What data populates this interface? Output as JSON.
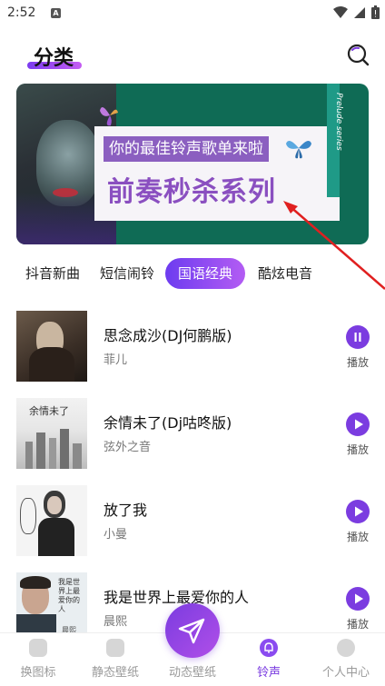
{
  "status_bar": {
    "time": "2:52",
    "notification_letter": "A"
  },
  "header": {
    "title": "分类"
  },
  "banner": {
    "subtitle": "你的最佳铃声歌单来啦",
    "title": "前奏秒杀系列",
    "vertical_text": "Prelude series"
  },
  "tabs": [
    {
      "label": "抖音新曲",
      "active": false
    },
    {
      "label": "短信闹铃",
      "active": false
    },
    {
      "label": "国语经典",
      "active": true
    },
    {
      "label": "酷炫电音",
      "active": false
    }
  ],
  "songs": [
    {
      "title": "思念成沙(DJ何鹏版)",
      "artist": "菲儿",
      "play_label": "播放",
      "state": "playing"
    },
    {
      "title": "余情未了(Dj咕咚版)",
      "artist": "弦外之音",
      "play_label": "播放",
      "state": "paused"
    },
    {
      "title": "放了我",
      "artist": "小曼",
      "play_label": "播放",
      "state": "paused"
    },
    {
      "title": "我是世界上最爱你的人",
      "artist": "晨熙",
      "play_label": "播放",
      "state": "paused"
    }
  ],
  "covers": {
    "song2_text": "余情未了",
    "song4_text": "我是世界上最爱你的人",
    "song4_artist": "晨熙"
  },
  "bottom_nav": [
    {
      "label": "换图标",
      "icon": "swap-icon",
      "active": false
    },
    {
      "label": "静态壁纸",
      "icon": "image-icon",
      "active": false
    },
    {
      "label": "动态壁纸",
      "icon": "send-icon",
      "active": false
    },
    {
      "label": "铃声",
      "icon": "bell-icon",
      "active": true
    },
    {
      "label": "个人中心",
      "icon": "user-icon",
      "active": false
    }
  ],
  "colors": {
    "accent": "#7b3ce0",
    "banner_green": "#0f6b55",
    "banner_purple": "#8b5fc0"
  }
}
